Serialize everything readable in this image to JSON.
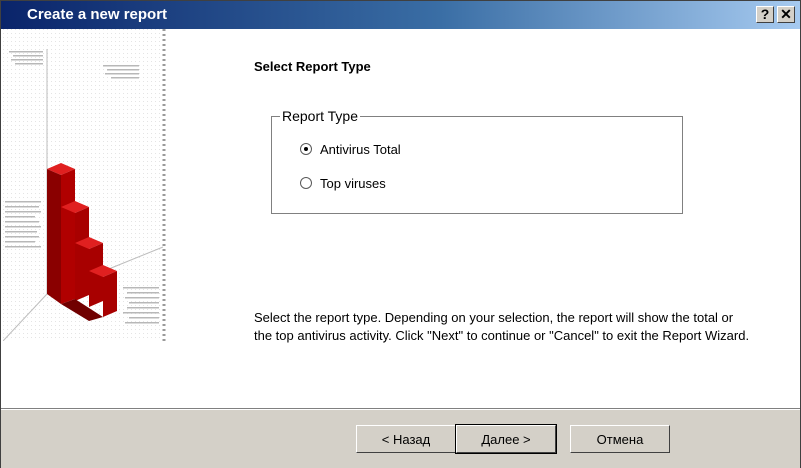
{
  "window": {
    "title": "Create a new report",
    "help_label": "?",
    "close_label": "✕"
  },
  "main": {
    "heading": "Select Report Type",
    "group": {
      "legend": "Report Type",
      "options": [
        {
          "label": "Antivirus Total",
          "checked": true
        },
        {
          "label": "Top viruses",
          "checked": false
        }
      ]
    },
    "description": "Select the report type. Depending on your selection, the report will show the total or the top antivirus activity. Click \"Next\" to continue or \"Cancel\" to exit the Report Wizard."
  },
  "footer": {
    "back_label": "< Назад",
    "next_label": "Далее >",
    "cancel_label": "Отмена"
  },
  "colors": {
    "title_start": "#0a246a",
    "title_end": "#a6caf0",
    "bar_red": "#c00000"
  },
  "icons": {
    "help": "help-icon",
    "close": "close-icon",
    "radio": "radio-button"
  }
}
